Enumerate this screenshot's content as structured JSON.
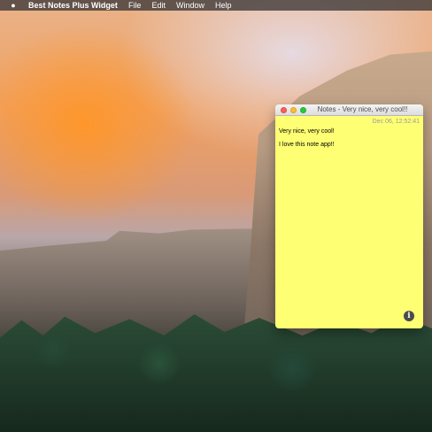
{
  "menubar": {
    "apple_icon": "apple-icon",
    "app_name": "Best Notes Plus Widget",
    "items": [
      "File",
      "Edit",
      "Window",
      "Help"
    ]
  },
  "notes_window": {
    "title": "Notes - Very nice, very cool!!",
    "timestamp": "Dec 06, 12:52:41",
    "lines": [
      "Very nice, very cool!",
      "I love this note app!!"
    ],
    "background_color": "#ffff73",
    "info_icon": "info-icon"
  }
}
